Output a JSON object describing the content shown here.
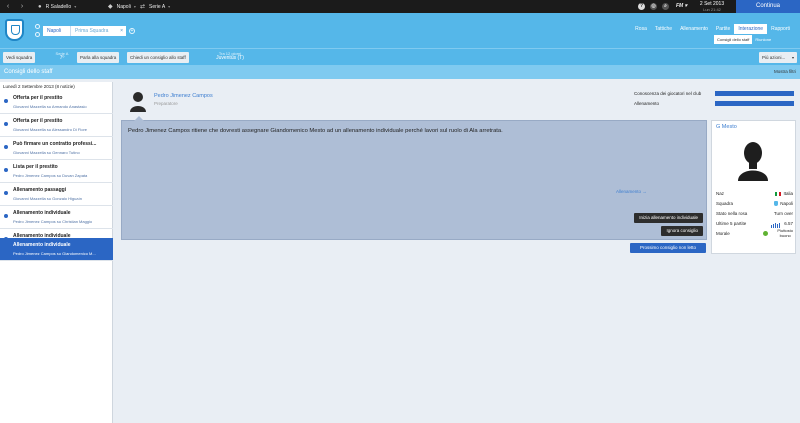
{
  "topbar": {
    "manager_name": "R Saladello",
    "club": "Napoli",
    "league": "Serie A",
    "help_label": "?",
    "fm_label": "FM",
    "date": "2 Set 2013",
    "time": "Lun 21:42",
    "continue_label": "Continua"
  },
  "header": {
    "team_name": "Napoli",
    "squad": "Prima Squadra",
    "squad_close": "×",
    "squad_add": "+",
    "main_menu": [
      "Rosa",
      "Tattiche",
      "Allenamento",
      "Partite",
      "Interazione",
      "Rapporti"
    ],
    "active_main": "Interazione",
    "sub_menu": [
      "Consigli dello staff",
      "Riunione"
    ],
    "active_sub": "Consigli dello staff"
  },
  "actionbar": {
    "view_squad": "Vedi squadra",
    "league_small": "Serie A",
    "league_pos": "7º",
    "talk_to_squad": "Parla alla squadra",
    "ask_staff_advice": "Chiedi un consiglio allo staff",
    "next_match_small": "Tra 12 giorni",
    "next_match": "Juventus (T)",
    "more_options": "Più azioni..."
  },
  "titlebar": {
    "title": "Consigli dello staff",
    "filters": "Mostra filtri"
  },
  "news_list": {
    "date_header": "Lunedì 2 Settembre 2013 (8 notizie)",
    "items": [
      {
        "title": "Offerta per il prestito",
        "subtitle": "Giovanni Mazzella su Armando Anastasio"
      },
      {
        "title": "Offerta per il prestito",
        "subtitle": "Giovanni Mazzella su Alessandro Di Fiore"
      },
      {
        "title": "Può firmare un contratto professi...",
        "subtitle": "Giovanni Mazzella su Gennaro Tutino"
      },
      {
        "title": "Lista per il prestito",
        "subtitle": "Pedro Jimenez Campos su Duvan Zapata"
      },
      {
        "title": "Allenamento passaggi",
        "subtitle": "Giovanni Mazzella su Gonzalo Higuaín"
      },
      {
        "title": "Allenamento individuale",
        "subtitle": "Pedro Jimenez Campos su Christian Maggio"
      },
      {
        "title": "Allenamento individuale",
        "subtitle": "Pedro Jimenez Campos su Valon Behrami"
      },
      {
        "title": "Allenamento individuale",
        "subtitle": "Pedro Jimenez Campos su Giandomenico M..."
      }
    ],
    "selected_index": 7
  },
  "advice": {
    "author_name": "Pedro Jimenez Campos",
    "author_role": "Preparatore",
    "stat_1_label": "Conoscenza dei giocatori nel club",
    "stat_2_label": "Allenamento",
    "stat_1_level": 1.0,
    "stat_2_level": 1.0,
    "text": "Pedro Jimenez Campos ritiene che dovresti assegnare Giandomenico Mesto ad un allenamento individuale perché lavori sul ruolo di Ala arretrata.",
    "start_training": "Inizia allenamento individuale",
    "ignore_advice": "Ignora consiglio",
    "training_link": "Allenamento →",
    "next_unread": "Prossimo consiglio non letto"
  },
  "player_card": {
    "name": "G Mesto",
    "nation_label": "Naz",
    "nation_value": "Italia",
    "club_label": "Squadra",
    "club_value": "Napoli",
    "status_label": "Stato nella rosa",
    "status_value": "Turn over",
    "form_label": "Ultime 5 partite",
    "form_value": "6.57",
    "morale_label": "Morale",
    "morale_value_1": "Piuttosto",
    "morale_value_2": "buono",
    "flag_colors": [
      "#119a3b",
      "#ffffff",
      "#d21a25"
    ]
  },
  "colors": {
    "accent_blue": "#2b66c4",
    "header_blue": "#55b7e9",
    "advice_bg": "#aebed6"
  }
}
